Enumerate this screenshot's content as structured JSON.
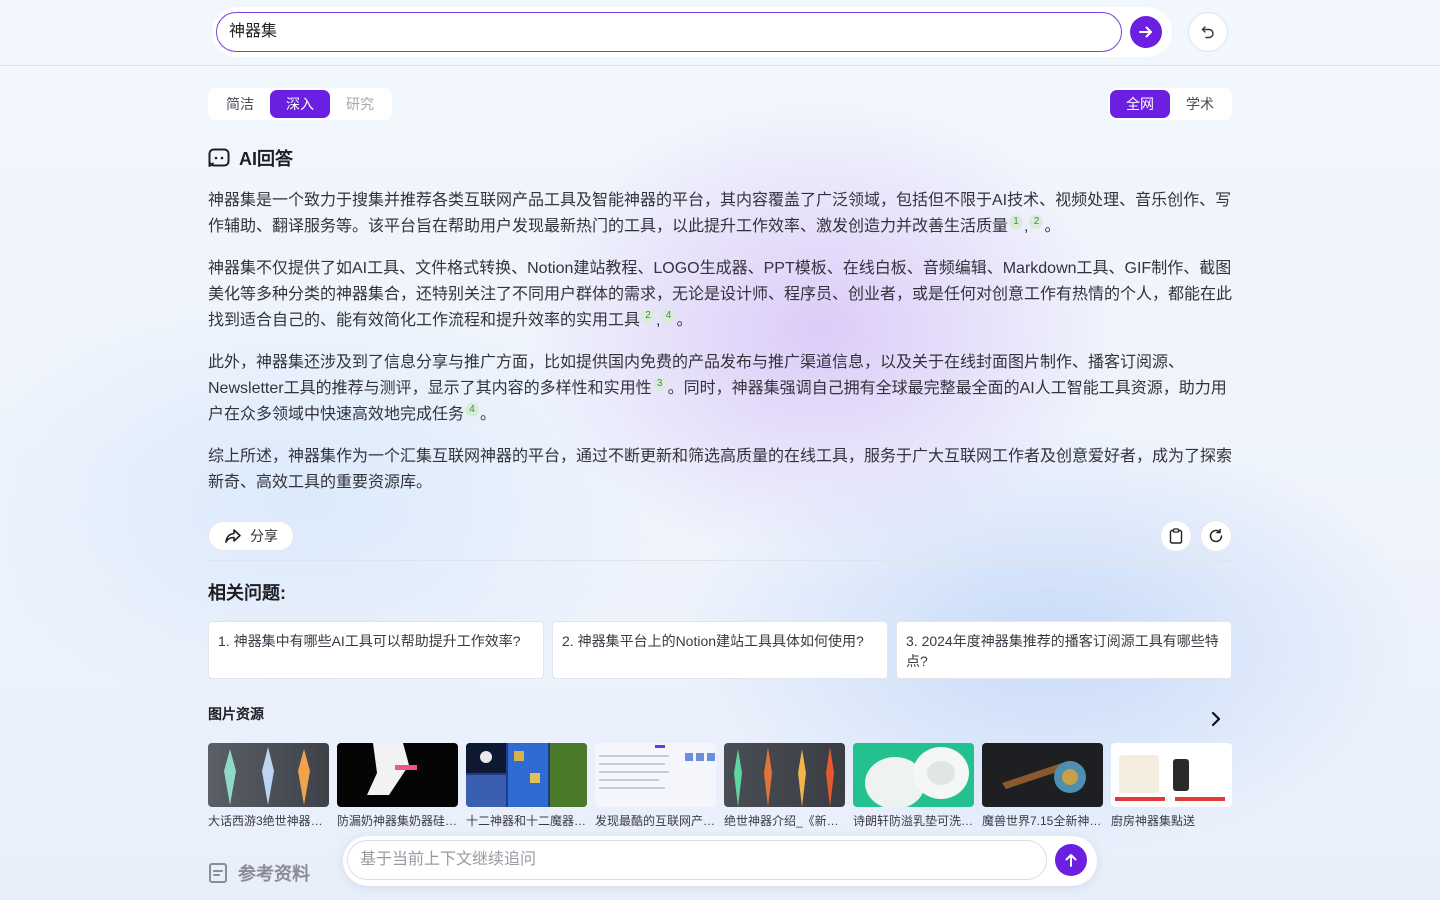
{
  "search": {
    "query": "神器集"
  },
  "mode_tabs": [
    {
      "label": "简洁",
      "state": "normal"
    },
    {
      "label": "深入",
      "state": "active"
    },
    {
      "label": "研究",
      "state": "disabled"
    }
  ],
  "scope_tabs": [
    {
      "label": "全网",
      "state": "active"
    },
    {
      "label": "学术",
      "state": "normal"
    }
  ],
  "answer": {
    "heading": "AI回答",
    "paragraphs": [
      {
        "text": "神器集是一个致力于搜集并推荐各类互联网产品工具及智能神器的平台，其内容覆盖了广泛领域，包括但不限于AI技术、视频处理、音乐创作、写作辅助、翻译服务等。该平台旨在帮助用户发现最新热门的工具，以此提升工作效率、激发创造力并改善生活质量",
        "cites": [
          "1",
          "2"
        ],
        "tail": "。"
      },
      {
        "text": "神器集不仅提供了如AI工具、文件格式转换、Notion建站教程、LOGO生成器、PPT模板、在线白板、音频编辑、Markdown工具、GIF制作、截图美化等多种分类的神器集合，还特别关注了不同用户群体的需求，无论是设计师、程序员、创业者，或是任何对创意工作有热情的个人，都能在此找到适合自己的、能有效简化工作流程和提升效率的实用工具",
        "cites": [
          "2",
          "4"
        ],
        "tail": "。"
      },
      {
        "text": "此外，神器集还涉及到了信息分享与推广方面，比如提供国内免费的产品发布与推广渠道信息，以及关于在线封面图片制作、播客订阅源、Newsletter工具的推荐与测评，显示了其内容的多样性和实用性",
        "cites": [
          "3"
        ],
        "mid": "。同时，神器集强调自己拥有全球最完整最全面的AI人工智能工具资源，助力用户在众多领域中快速高效地完成任务",
        "cites2": [
          "4"
        ],
        "tail": "。"
      },
      {
        "text": "综上所述，神器集作为一个汇集互联网神器的平台，通过不断更新和筛选高质量的在线工具，服务于广大互联网工作者及创意爱好者，成为了探索新奇、高效工具的重要资源库。",
        "cites": [],
        "tail": ""
      }
    ]
  },
  "actions": {
    "share_label": "分享"
  },
  "related": {
    "title": "相关问题:",
    "questions": [
      "1. 神器集中有哪些AI工具可以帮助提升工作效率?",
      "2. 神器集平台上的Notion建站工具具体如何使用?",
      "3. 2024年度神器集推荐的播客订阅源工具有哪些特点?"
    ]
  },
  "images": {
    "title": "图片资源",
    "items": [
      {
        "caption": "大话西游3绝世神器…"
      },
      {
        "caption": "防漏奶神器集奶器硅…"
      },
      {
        "caption": "十二神器和十二魔器…"
      },
      {
        "caption": "发现最酷的互联网产…"
      },
      {
        "caption": "绝世神器介绍_《新…"
      },
      {
        "caption": "诗朗轩防溢乳垫可洗…"
      },
      {
        "caption": "魔兽世界7.15全新神…"
      },
      {
        "caption": "廚房神器集點送"
      }
    ]
  },
  "references": {
    "title": "参考资料"
  },
  "followup": {
    "placeholder": "基于当前上下文继续追问"
  },
  "colors": {
    "accent": "#6b1fe0",
    "citation_bg": "#d9ecd9"
  }
}
